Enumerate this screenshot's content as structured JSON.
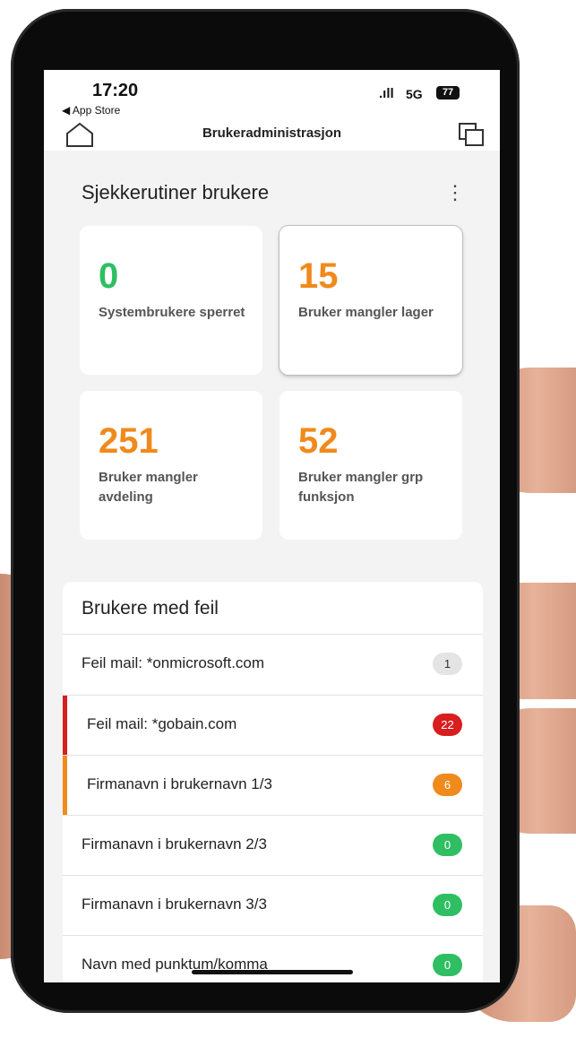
{
  "status_bar": {
    "time": "17:20",
    "back_label": "◀ App Store",
    "signal": ".ıll",
    "network": "5G",
    "battery": "77"
  },
  "header": {
    "title": "Brukeradministrasjon"
  },
  "checks": {
    "title": "Sjekkerutiner brukere",
    "menu_icon": "⋮",
    "tiles": [
      {
        "value": "0",
        "label": "Systembrukere sperret",
        "color": "#2fbf62"
      },
      {
        "value": "15",
        "label": "Bruker mangler lager",
        "color": "#f08a1c"
      },
      {
        "value": "251",
        "label": "Bruker mangler avdeling",
        "color": "#f08a1c"
      },
      {
        "value": "52",
        "label": "Bruker mangler grp funksjon",
        "color": "#f08a1c"
      }
    ]
  },
  "errors": {
    "title": "Brukere med feil",
    "rows": [
      {
        "label": "Feil mail: *onmicrosoft.com",
        "count": "1",
        "badge_color": "#e4e4e4",
        "badge_text_color": "#333333",
        "marker_color": ""
      },
      {
        "label": "Feil mail: *gobain.com",
        "count": "22",
        "badge_color": "#d81e1e",
        "badge_text_color": "#ffffff",
        "marker_color": "#d81e1e"
      },
      {
        "label": "Firmanavn i brukernavn 1/3",
        "count": "6",
        "badge_color": "#f08a1c",
        "badge_text_color": "#ffffff",
        "marker_color": "#f08a1c"
      },
      {
        "label": "Firmanavn i brukernavn 2/3",
        "count": "0",
        "badge_color": "#2fbf62",
        "badge_text_color": "#ffffff",
        "marker_color": ""
      },
      {
        "label": "Firmanavn i brukernavn 3/3",
        "count": "0",
        "badge_color": "#2fbf62",
        "badge_text_color": "#ffffff",
        "marker_color": ""
      },
      {
        "label": "Navn med punktum/komma",
        "count": "0",
        "badge_color": "#2fbf62",
        "badge_text_color": "#ffffff",
        "marker_color": ""
      }
    ]
  }
}
